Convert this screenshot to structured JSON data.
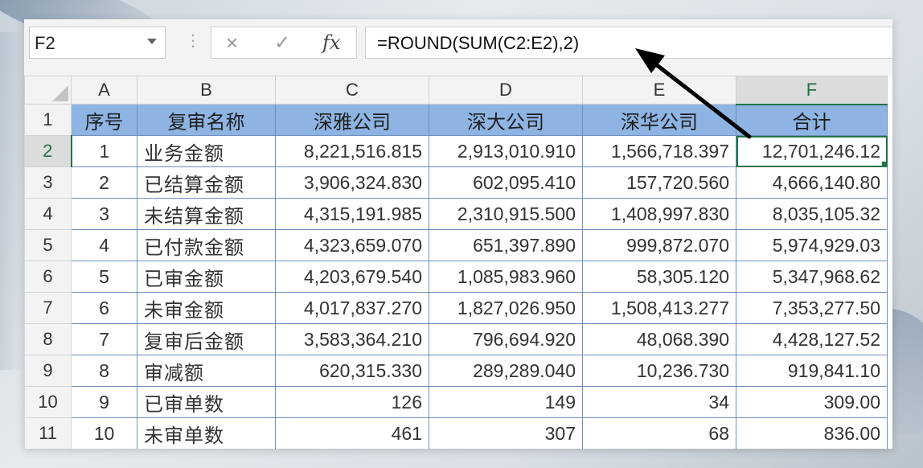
{
  "name_box": "F2",
  "formula_bar": {
    "cancel_icon": "×",
    "enter_icon": "✓",
    "fx_label": "fx",
    "formula": "=ROUND(SUM(C2:E2),2)"
  },
  "column_headers": [
    "A",
    "B",
    "C",
    "D",
    "E",
    "F"
  ],
  "row_headers": [
    "1",
    "2",
    "3",
    "4",
    "5",
    "6",
    "7",
    "8",
    "9",
    "10",
    "11"
  ],
  "header_row": [
    "序号",
    "复审名称",
    "深雅公司",
    "深大公司",
    "深华公司",
    "合计"
  ],
  "rows": [
    [
      "1",
      "业务金额",
      "8,221,516.815",
      "2,913,010.910",
      "1,566,718.397",
      "12,701,246.12"
    ],
    [
      "2",
      "已结算金额",
      "3,906,324.830",
      "602,095.410",
      "157,720.560",
      "4,666,140.80"
    ],
    [
      "3",
      "未结算金额",
      "4,315,191.985",
      "2,310,915.500",
      "1,408,997.830",
      "8,035,105.32"
    ],
    [
      "4",
      "已付款金额",
      "4,323,659.070",
      "651,397.890",
      "999,872.070",
      "5,974,929.03"
    ],
    [
      "5",
      "已审金额",
      "4,203,679.540",
      "1,085,983.960",
      "58,305.120",
      "5,347,968.62"
    ],
    [
      "6",
      "未审金额",
      "4,017,837.270",
      "1,827,026.950",
      "1,508,413.277",
      "7,353,277.50"
    ],
    [
      "7",
      "复审后金额",
      "3,583,364.210",
      "796,694.920",
      "48,068.390",
      "4,428,127.52"
    ],
    [
      "8",
      "审减额",
      "620,315.330",
      "289,289.040",
      "10,236.730",
      "919,841.10"
    ],
    [
      "9",
      "已审单数",
      "126",
      "149",
      "34",
      "309.00"
    ],
    [
      "10",
      "未审单数",
      "461",
      "307",
      "68",
      "836.00"
    ]
  ],
  "colors": {
    "header_fill": "#8db4e2",
    "selection": "#217346"
  }
}
